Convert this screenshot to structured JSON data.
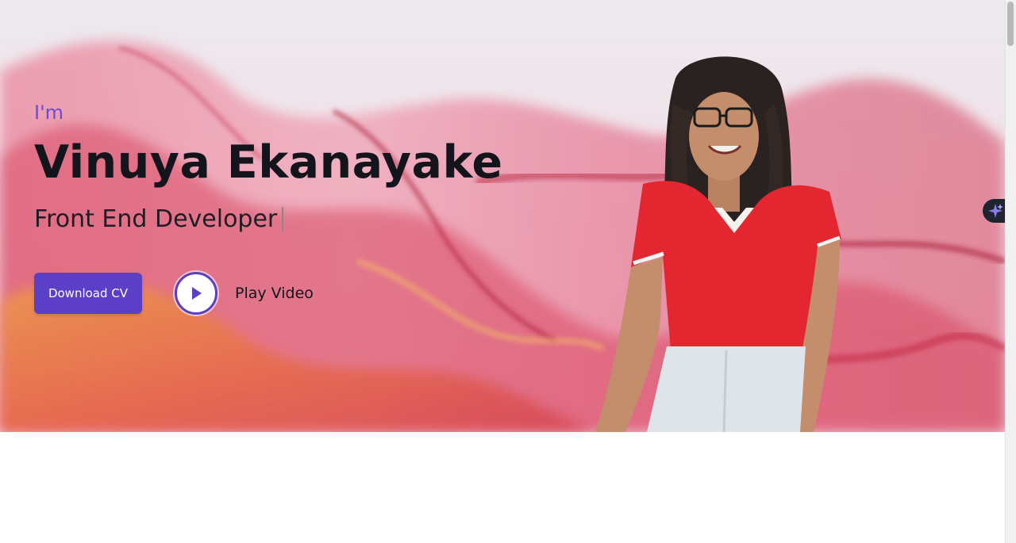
{
  "hero": {
    "intro": "I'm",
    "name": "Vinuya Ekanayake",
    "role": "Front End Developer"
  },
  "actions": {
    "download_cv": "Download CV",
    "play_video": "Play Video"
  },
  "icons": {
    "play": "play-icon",
    "assistant": "sparkle-icon"
  },
  "colors": {
    "accent": "#5b3fc6",
    "intro_text": "#6a4bd6",
    "heading": "#14141c"
  }
}
